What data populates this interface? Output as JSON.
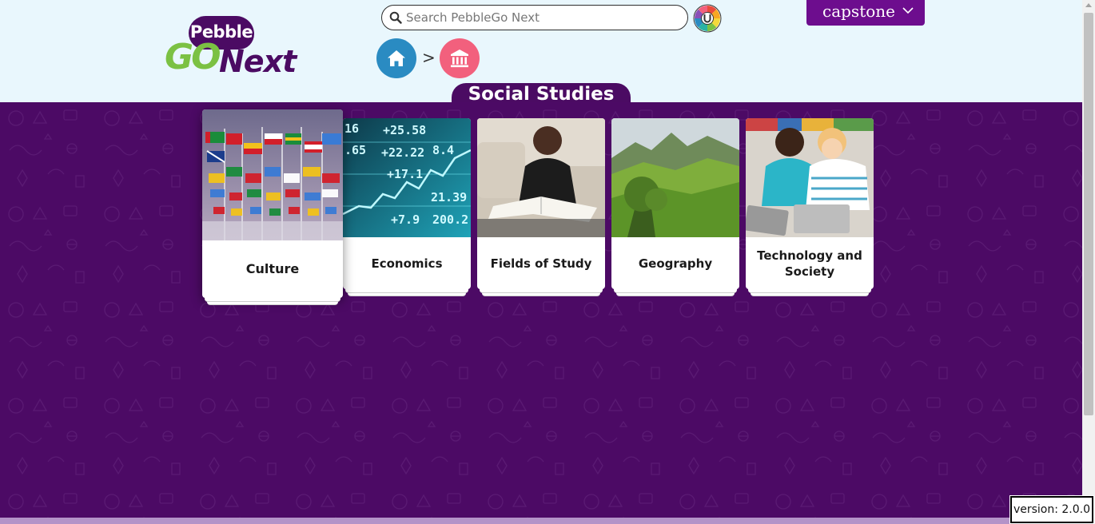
{
  "header": {
    "logo": {
      "top": "Pebble",
      "go": "GO",
      "next": "Next"
    },
    "search": {
      "placeholder": "Search PebbleGo Next",
      "value": ""
    },
    "publisher_menu": "capstone",
    "breadcrumb": {
      "separator": ">"
    }
  },
  "section": {
    "title": "Social Studies"
  },
  "cards": [
    {
      "label": "Culture",
      "icon": "flags-photo",
      "selected": true
    },
    {
      "label": "Economics",
      "icon": "stock-ticker-photo"
    },
    {
      "label": "Fields of Study",
      "icon": "student-reading-photo"
    },
    {
      "label": "Geography",
      "icon": "landscape-photo"
    },
    {
      "label": "Technology and Society",
      "icon": "kids-tablets-photo"
    }
  ],
  "footer": {
    "version": "version: 2.0.0"
  },
  "colors": {
    "brand_purple": "#4b0b63",
    "header_bg": "#e9f7fd",
    "home_blue": "#2a8bc2",
    "section_pink": "#f2607d",
    "logo_green": "#7bc143",
    "capstone_purple": "#6d0d8e"
  }
}
